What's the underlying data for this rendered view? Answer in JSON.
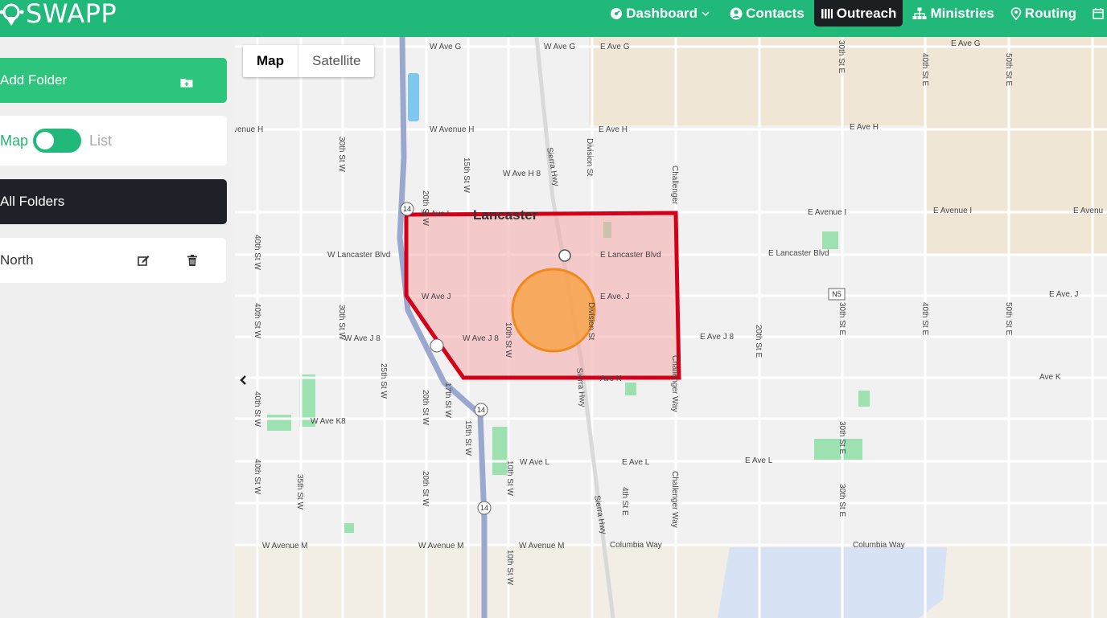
{
  "app": {
    "name": "SWAPP"
  },
  "nav": [
    {
      "label": "Dashboard",
      "icon": "dashboard-icon",
      "has_dropdown": true,
      "active": false
    },
    {
      "label": "Contacts",
      "icon": "user-circle-icon",
      "active": false
    },
    {
      "label": "Outreach",
      "icon": "columns-icon",
      "active": true
    },
    {
      "label": "Ministries",
      "icon": "sitemap-icon",
      "active": false
    },
    {
      "label": "Routing",
      "icon": "map-pin-icon",
      "active": false
    }
  ],
  "sidebar": {
    "add_folder_label": "Add Folder",
    "toggle": {
      "map_label": "Map",
      "list_label": "List",
      "selected": "Map"
    },
    "all_folders_label": "All Folders",
    "folders": [
      {
        "name": "North"
      }
    ]
  },
  "map": {
    "tabs": [
      {
        "label": "Map",
        "active": true
      },
      {
        "label": "Satellite",
        "active": false
      }
    ],
    "city_label": "Lancaster",
    "road_labels": {
      "w_ave_g": "W Ave G",
      "w_ave_g2": "W Ave G",
      "e_ave_g": "E Ave G",
      "e_ave_g2": "E Ave G",
      "w_ave_h": "W Avenue H",
      "ave_h_left": "venue H",
      "e_ave_h": "E Ave H",
      "e_ave_h2": "E Ave H",
      "w_ave_h8": "W Ave H 8",
      "w_ave_i": "W Ave I",
      "e_ave_i": "E Avenue I",
      "e_ave_i2": "E Avenue I",
      "e_ave_i3": "E Avenu",
      "w_lancaster": "W Lancaster Blvd",
      "e_lancaster": "E Lancaster Blvd",
      "e_lancaster2": "E Lancaster Blvd",
      "w_ave_j": "W Ave J",
      "e_ave_j": "E Ave. J",
      "e_ave_j2": "E Ave. J",
      "w_ave_j8": "W Ave J 8",
      "w_ave_j8b": "W Ave J 8",
      "e_ave_j8": "E Ave J 8",
      "w_ave_k8": "W Ave K8",
      "e_ave_k": "Ave K",
      "ave_k": "Ave K",
      "w_ave_l": "W Ave L",
      "e_ave_l": "E Ave L",
      "e_ave_l2": "E Ave L",
      "w_ave_m": "W Avenue M",
      "w_ave_m2": "W Avenue M",
      "w_ave_m3": "W Avenue M",
      "columbia": "Columbia Way",
      "columbia2": "Columbia Way",
      "s30w": "30th St W",
      "s30w2": "30th St W",
      "s40w": "40th St W",
      "s40w2": "40th St W",
      "s40w3": "40th St W",
      "s40w4": "40th St W",
      "s25w": "25th St W",
      "s35w": "35th St W",
      "s20w": "20th St W",
      "s20w2": "20th St W",
      "s20w3": "20th St W",
      "s15w": "15th St W",
      "s15w2": "15th St W",
      "s17w": "17th St W",
      "s10w": "10th St W",
      "s10w2": "10th St W",
      "s10w3": "10th St W",
      "sierra": "Sierra Hwy",
      "sierra2": "Sierra Hwy",
      "sierra3": "Sierra Hwy",
      "division": "Division St",
      "division2": "Division St",
      "challenger": "Challenger",
      "challenger2": "Challenger Way",
      "challenger3": "Challenger Way",
      "s20e": "20th St E",
      "s4e": "4th St E",
      "s30e": "30th St E",
      "s30e2": "30th St E",
      "s30e3": "30th St E",
      "s30e4": "30th St E",
      "s40e": "40th St E",
      "s40e2": "40th St E",
      "s50e": "50th St E",
      "s50e2": "50th St E",
      "hwy14": "14",
      "hwy14b": "14",
      "hwy14c": "14",
      "hwy_n5": "N5"
    }
  },
  "colors": {
    "brand": "#21b97a",
    "dark": "#1e2228",
    "polygon_fill": "#f4a7a7",
    "polygon_stroke": "#d4001a",
    "circle": "#f7a34a"
  }
}
